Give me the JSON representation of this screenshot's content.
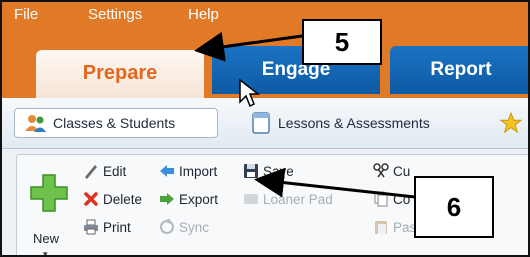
{
  "menu": {
    "file": "File",
    "settings": "Settings",
    "help": "Help"
  },
  "tabs": {
    "prepare": "Prepare",
    "engage": "Engage",
    "report": "Report"
  },
  "subtabs": {
    "classes": "Classes & Students",
    "lessons": "Lessons & Assessments"
  },
  "ribbon": {
    "new": "New",
    "edit": "Edit",
    "delete": "Delete",
    "print": "Print",
    "import": "Import",
    "export": "Export",
    "sync": "Sync",
    "save": "Save",
    "loaner_pad": "Loaner Pad",
    "cut": "Cu",
    "copy": "Co",
    "paste": "Paste"
  },
  "callouts": {
    "first": "5",
    "second": "6"
  },
  "colors": {
    "menu_orange": "#e07a26",
    "tab_blue": "#1565b5",
    "prepare_text": "#e3671d"
  }
}
